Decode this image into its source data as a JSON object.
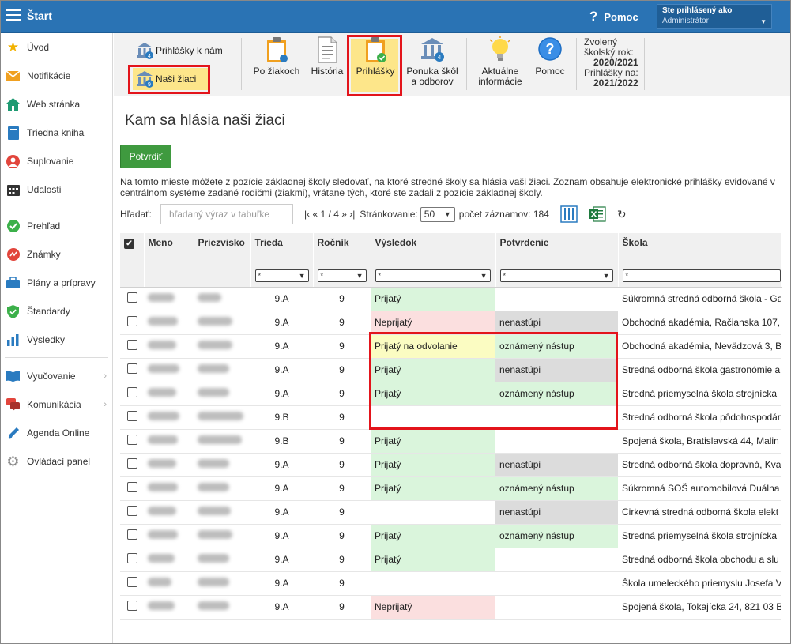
{
  "topbar": {
    "title": "Štart",
    "help": "Pomoc",
    "help_symbol": "?",
    "user_label": "Ste prihlásený ako",
    "user_name": "Administrátor"
  },
  "sidebar": {
    "items": [
      {
        "label": "Úvod",
        "icon": "star-icon"
      },
      {
        "label": "Notifikácie",
        "icon": "envelope-icon"
      },
      {
        "label": "Web stránka",
        "icon": "home-icon"
      },
      {
        "label": "Triedna kniha",
        "icon": "book-icon"
      },
      {
        "label": "Suplovanie",
        "icon": "substitute-icon"
      },
      {
        "label": "Udalosti",
        "icon": "calendar-icon"
      },
      {
        "label": "Prehľad",
        "icon": "check-circle-icon"
      },
      {
        "label": "Známky",
        "icon": "grades-icon"
      },
      {
        "label": "Plány a prípravy",
        "icon": "briefcase-icon"
      },
      {
        "label": "Štandardy",
        "icon": "shield-check-icon"
      },
      {
        "label": "Výsledky",
        "icon": "bar-chart-icon"
      },
      {
        "label": "Vyučovanie",
        "icon": "open-book-icon"
      },
      {
        "label": "Komunikácia",
        "icon": "chat-icon"
      },
      {
        "label": "Agenda Online",
        "icon": "pen-icon"
      },
      {
        "label": "Ovládací panel",
        "icon": "gear-icon"
      }
    ]
  },
  "ribbon": {
    "prihlasky_k_nam": "Prihlášky k nám",
    "nasi_ziaci": "Naši žiaci",
    "badge_4": "4",
    "badge_9": "9",
    "po_ziakoch": "Po žiakoch",
    "historia": "História",
    "prihlasky": "Prihlášky",
    "ponuka_1": "Ponuka škôl",
    "ponuka_2": "a odborov",
    "aktualne_1": "Aktuálne",
    "aktualne_2": "informácie",
    "pomoc": "Pomoc",
    "year_label_1": "Zvolený",
    "year_label_2": "školský rok:",
    "year_value": "2020/2021",
    "apps_label": "Prihlášky na:",
    "apps_value": "2021/2022"
  },
  "main": {
    "title": "Kam sa hlásia naši žiaci",
    "confirm": "Potvrdiť",
    "description": "Na tomto mieste môžete z pozície základnej školy sledovať, na ktoré stredné školy sa hlásia vaši žiaci. Zoznam obsahuje elektronické prihlášky evidované v centrálnom systéme zadané rodičmi (žiakmi), vrátane tých, ktoré ste zadali z pozície základnej školy.",
    "search_label": "Hľadať:",
    "search_placeholder": "hľadaný výraz v tabuľke",
    "pager_first": "|‹",
    "pager_prev": "«",
    "pager_pages": "1 / 4",
    "pager_next": "»",
    "pager_last": "›|",
    "page_size_label": "Stránkovanie:",
    "page_size": "50",
    "count_label": "počet záznamov: 184",
    "filter_any": "*"
  },
  "table": {
    "headers": [
      "Meno",
      "Priezvisko",
      "Trieda",
      "Ročník",
      "Výsledok",
      "Potvrdenie",
      "Škola"
    ],
    "rows": [
      {
        "trieda": "9.A",
        "rocnik": "9",
        "vysledok": "Prijatý",
        "vclass": "bg-green",
        "potvrdenie": "",
        "pclass": "",
        "skola": "Súkromná stredná odborná škola - Ga"
      },
      {
        "trieda": "9.A",
        "rocnik": "9",
        "vysledok": "Neprijatý",
        "vclass": "bg-red",
        "potvrdenie": "nenastúpi",
        "pclass": "bg-gray",
        "skola": "Obchodná akadémia, Račianska 107,"
      },
      {
        "trieda": "9.A",
        "rocnik": "9",
        "vysledok": "Prijatý na odvolanie",
        "vclass": "bg-yellow",
        "potvrdenie": "oznámený nástup",
        "pclass": "bg-green",
        "skola": "Obchodná akadémia, Nevädzová 3, B"
      },
      {
        "trieda": "9.A",
        "rocnik": "9",
        "vysledok": "Prijatý",
        "vclass": "bg-green",
        "potvrdenie": "nenastúpi",
        "pclass": "bg-gray",
        "skola": "Stredná odborná škola gastronómie a"
      },
      {
        "trieda": "9.A",
        "rocnik": "9",
        "vysledok": "Prijatý",
        "vclass": "bg-green",
        "potvrdenie": "oznámený nástup",
        "pclass": "bg-green",
        "skola": "Stredná priemyselná škola strojnícka"
      },
      {
        "trieda": "9.B",
        "rocnik": "9",
        "vysledok": "",
        "vclass": "",
        "potvrdenie": "",
        "pclass": "",
        "skola": "Stredná odborná škola pôdohospodár"
      },
      {
        "trieda": "9.B",
        "rocnik": "9",
        "vysledok": "Prijatý",
        "vclass": "bg-green",
        "potvrdenie": "",
        "pclass": "",
        "skola": "Spojená škola, Bratislavská 44, Malin"
      },
      {
        "trieda": "9.A",
        "rocnik": "9",
        "vysledok": "Prijatý",
        "vclass": "bg-green",
        "potvrdenie": "nenastúpi",
        "pclass": "bg-gray",
        "skola": "Stredná odborná škola dopravná, Kva"
      },
      {
        "trieda": "9.A",
        "rocnik": "9",
        "vysledok": "Prijatý",
        "vclass": "bg-green",
        "potvrdenie": "oznámený nástup",
        "pclass": "bg-green",
        "skola": "Súkromná SOŠ automobilová Duálna"
      },
      {
        "trieda": "9.A",
        "rocnik": "9",
        "vysledok": "",
        "vclass": "",
        "potvrdenie": "nenastúpi",
        "pclass": "bg-gray",
        "skola": "Cirkevná stredná odborná škola elekt"
      },
      {
        "trieda": "9.A",
        "rocnik": "9",
        "vysledok": "Prijatý",
        "vclass": "bg-green",
        "potvrdenie": "oznámený nástup",
        "pclass": "bg-green",
        "skola": "Stredná priemyselná škola strojnícka"
      },
      {
        "trieda": "9.A",
        "rocnik": "9",
        "vysledok": "Prijatý",
        "vclass": "bg-green",
        "potvrdenie": "",
        "pclass": "",
        "skola": "Stredná odborná škola obchodu a slu"
      },
      {
        "trieda": "9.A",
        "rocnik": "9",
        "vysledok": "",
        "vclass": "",
        "potvrdenie": "",
        "pclass": "",
        "skola": "Škola umeleckého priemyslu Josefa V"
      },
      {
        "trieda": "9.A",
        "rocnik": "9",
        "vysledok": "Neprijatý",
        "vclass": "bg-red",
        "potvrdenie": "",
        "pclass": "",
        "skola": "Spojená škola, Tokajícka 24, 821 03 B"
      }
    ]
  },
  "colors": {
    "topbar": "#2a73b4",
    "highlight_border": "#e3141b",
    "confirm": "#3f9a3f"
  }
}
